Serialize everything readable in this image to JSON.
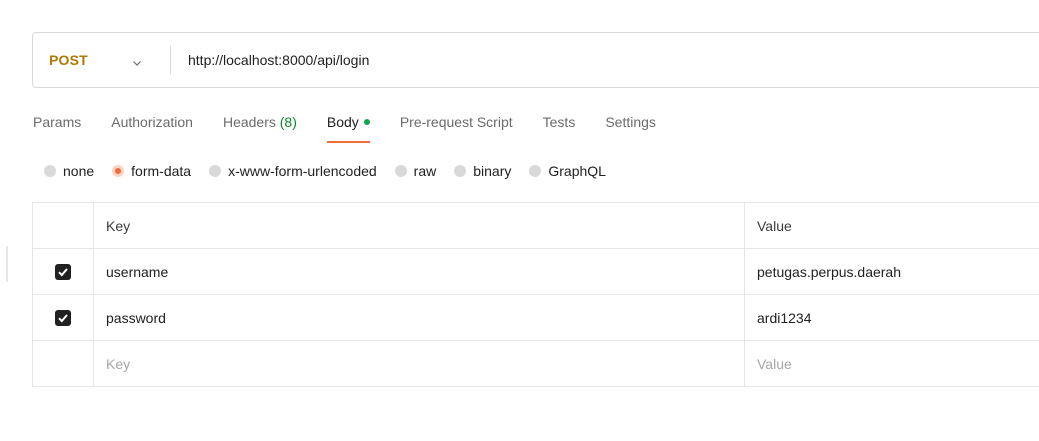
{
  "request": {
    "method": "POST",
    "url": "http://localhost:8000/api/login"
  },
  "tabs": [
    {
      "label": "Params"
    },
    {
      "label": "Authorization"
    },
    {
      "label": "Headers",
      "count": "(8)"
    },
    {
      "label": "Body",
      "active": true
    },
    {
      "label": "Pre-request Script"
    },
    {
      "label": "Tests"
    },
    {
      "label": "Settings"
    }
  ],
  "body_types": [
    {
      "label": "none"
    },
    {
      "label": "form-data",
      "selected": true
    },
    {
      "label": "x-www-form-urlencoded"
    },
    {
      "label": "raw"
    },
    {
      "label": "binary"
    },
    {
      "label": "GraphQL"
    }
  ],
  "table": {
    "headers": {
      "key": "Key",
      "value": "Value"
    },
    "rows": [
      {
        "checked": true,
        "key": "username",
        "value": "petugas.perpus.daerah"
      },
      {
        "checked": true,
        "key": "password",
        "value": "ardi1234"
      }
    ],
    "placeholder": {
      "key": "Key",
      "value": "Value"
    }
  },
  "colors": {
    "method": "#ad7a03",
    "accent": "#f26b3a",
    "body_dot": "#0ca653",
    "headers_count": "#0c8a2e"
  }
}
